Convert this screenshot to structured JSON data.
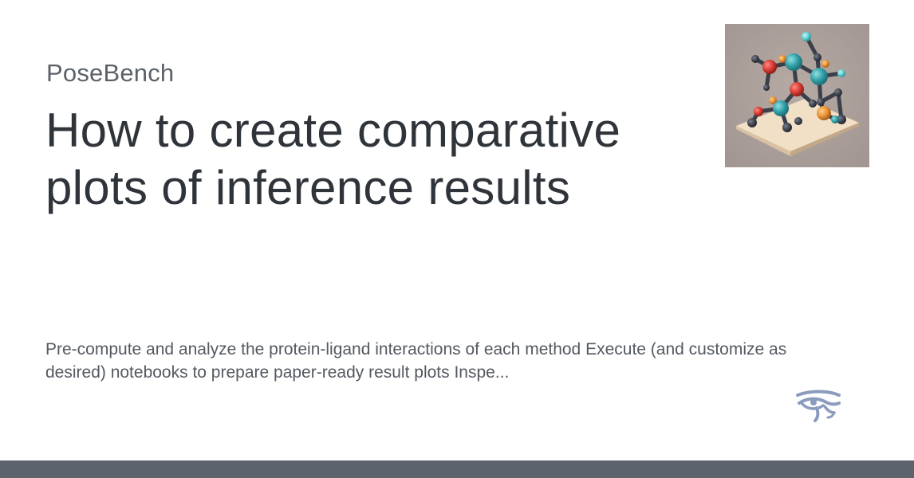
{
  "card": {
    "site_name": "PoseBench",
    "title": "How to create comparative plots of inference results",
    "description": "Pre-compute and analyze the protein-ligand interactions of each method Execute (and customize as desired) notebooks to prepare paper-ready result plots Inspe..."
  },
  "thumbnail": {
    "icon": "molecule-illustration-icon"
  },
  "logo": {
    "icon": "eye-of-horus-icon"
  },
  "colors": {
    "background": "#ffffff",
    "title_text": "#2f343b",
    "secondary_text": "#5c626a",
    "footer_bar": "#5d636d",
    "logo": "#8a9bbd"
  }
}
